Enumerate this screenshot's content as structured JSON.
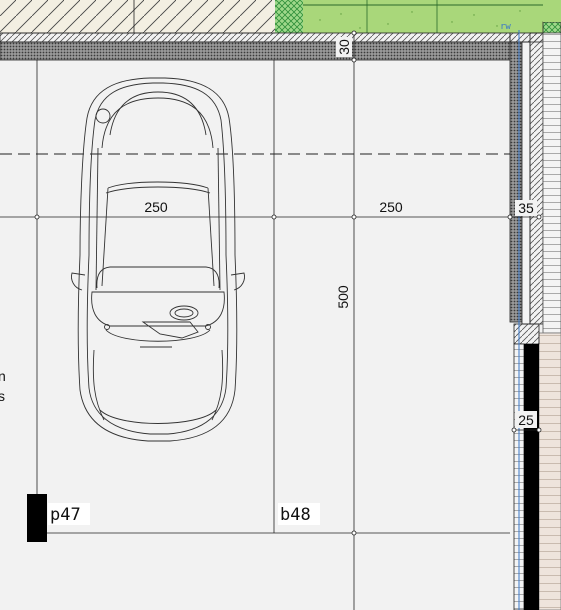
{
  "dimensions": {
    "wall_top": "30",
    "bay_width_left": "250",
    "bay_width_right": "250",
    "bay_depth": "500",
    "wall_right": "35",
    "side_wall": "25"
  },
  "labels": {
    "space_left": "p47",
    "space_right": "b48",
    "rw_tag": "rw",
    "edge_text_top": "n",
    "edge_text_bottom": "s"
  },
  "colors": {
    "background": "#f2f2f2",
    "grass": "#a9d77a",
    "wall_hatch": "#777777",
    "column": "#000000",
    "guide_line": "#3a78c8"
  },
  "icons": [
    "car-top-view-icon",
    "hatch-pattern",
    "column-block"
  ]
}
